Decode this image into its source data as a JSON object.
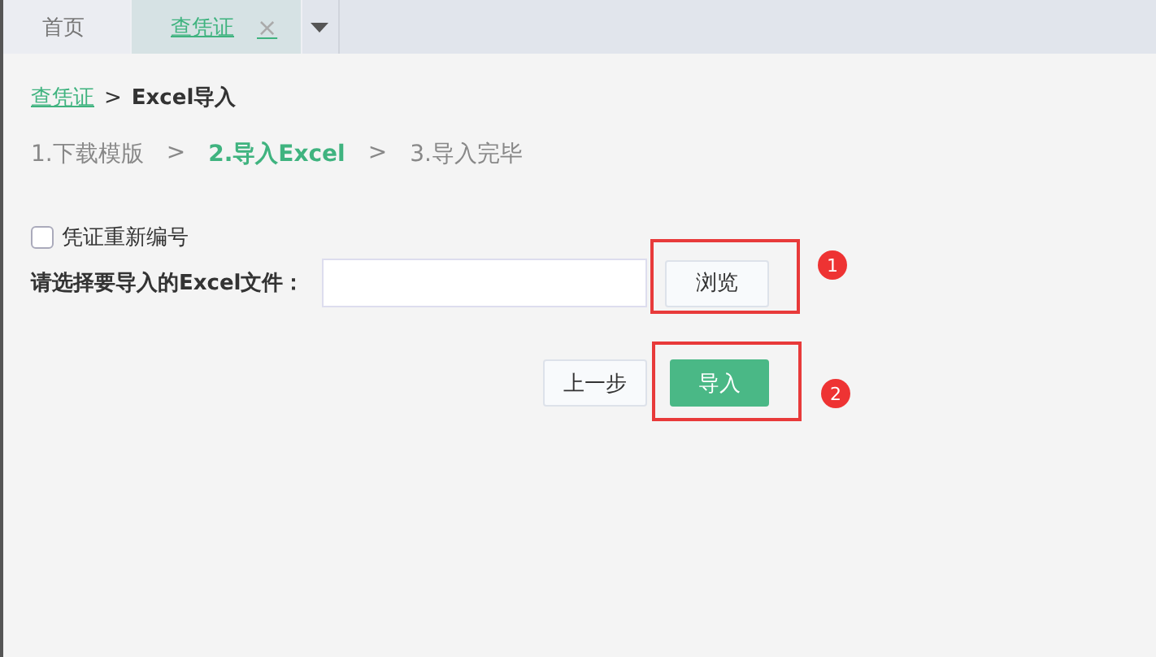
{
  "tabs": [
    {
      "label": "首页",
      "selected": false
    },
    {
      "label": "查凭证",
      "selected": true,
      "close": "×"
    }
  ],
  "breadcrumb": {
    "link": "查凭证",
    "separator": ">",
    "current": "Excel导入"
  },
  "steps": [
    {
      "label": "1.下载模版",
      "selected": false
    },
    {
      "label": "2.导入Excel",
      "selected": true
    },
    {
      "label": "3.导入完毕",
      "selected": false
    }
  ],
  "step_separator": ">",
  "renumber": {
    "label": "凭证重新编号",
    "checked": false
  },
  "file_field": {
    "label": "请选择要导入的Excel文件：",
    "browse": "浏览"
  },
  "buttons": [
    {
      "label": "上一步",
      "kind": "secondary"
    },
    {
      "label": "导入",
      "kind": "primary"
    }
  ],
  "annotations": [
    {
      "number": "1",
      "kind": "browse"
    },
    {
      "number": "2",
      "kind": "import"
    }
  ]
}
